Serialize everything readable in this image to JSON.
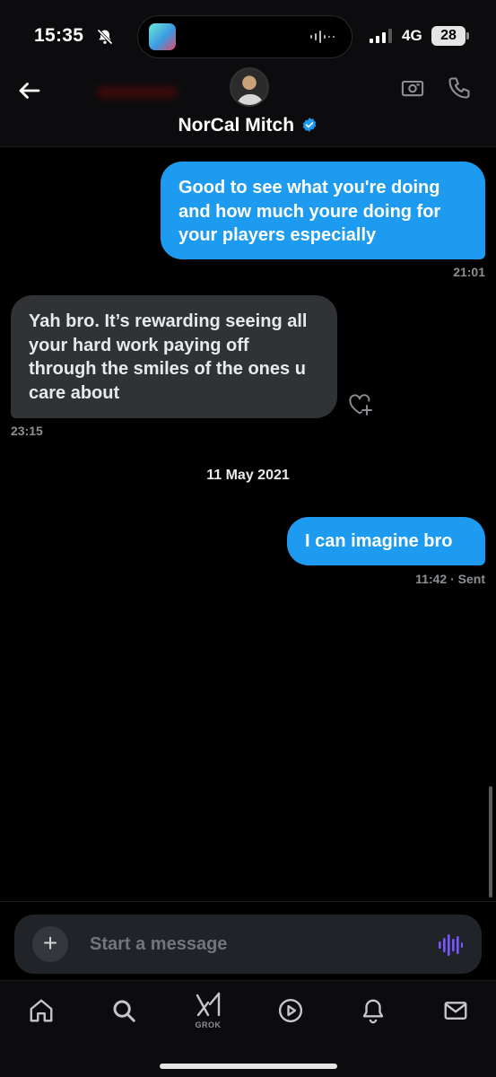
{
  "status_bar": {
    "time": "15:35",
    "network": "4G",
    "battery": "28"
  },
  "header": {
    "contact_name": "NorCal Mitch",
    "verified": true
  },
  "messages": [
    {
      "direction": "sent",
      "text": "Good to see what you're doing and how much youre doing for your players especially",
      "timestamp": "21:01"
    },
    {
      "direction": "received",
      "text": "Yah bro. It’s rewarding seeing all your hard work paying off through the smiles of the ones u care about",
      "timestamp": "23:15"
    },
    {
      "direction": "sent",
      "text": "I can imagine bro",
      "timestamp": "11:42 · Sent"
    }
  ],
  "date_separator": "11 May 2021",
  "composer": {
    "placeholder": "Start a message",
    "add_label": "+"
  },
  "bottom_nav": {
    "grok_label": "GROK"
  },
  "colors": {
    "accent": "#1d9bf0",
    "received_bubble": "#2f3336",
    "background": "#000000",
    "voice_icon": "#7856ff"
  }
}
